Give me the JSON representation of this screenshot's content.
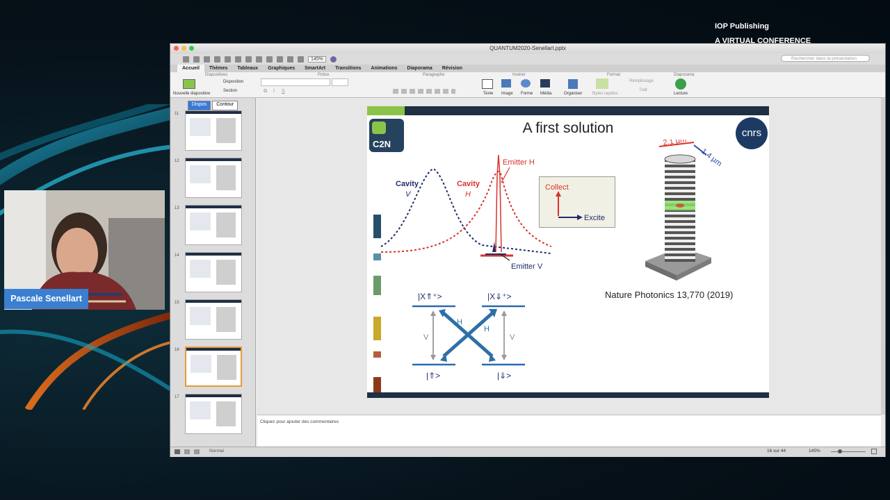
{
  "overlay": {
    "brand": "IOP Publishing",
    "subtitle": "A VIRTUAL CONFERENCE"
  },
  "speaker": {
    "name": "Pascale Senellart"
  },
  "window": {
    "title": "QUANTUM2020-Senellart.pptx",
    "zoom": "145%",
    "search_placeholder": "Rechercher dans la présentation"
  },
  "ribbon": {
    "tabs": [
      "Accueil",
      "Thèmes",
      "Tableaux",
      "Graphiques",
      "SmartArt",
      "Transitions",
      "Animations",
      "Diaporama",
      "Révision"
    ],
    "groups": {
      "diapositives": "Diapositives",
      "police": "Police",
      "paragraphe": "Paragraphe",
      "inserer": "Insérer",
      "format": "Format",
      "diaporama": "Diaporama"
    },
    "nouvelle_diapositive": "Nouvelle diapositive",
    "disposition": "Disposition",
    "section": "Section",
    "texte": "Texte",
    "image": "Image",
    "forme": "Forme",
    "media": "Média",
    "organiser": "Organiser",
    "styles_rapides": "Styles rapides",
    "remplissage": "Remplissage",
    "trait": "Trait",
    "lecture": "Lecture"
  },
  "panel": {
    "tab_slides": "Dispos",
    "tab_outline": "Contour",
    "slide_numbers": [
      "11",
      "12",
      "13",
      "14",
      "15",
      "16",
      "17"
    ],
    "selected": "16"
  },
  "slide": {
    "title": "A first solution",
    "logo_left": "C2N",
    "logo_right": "cnrs",
    "cavity_v": "Cavity",
    "cavity_v_sub": "V",
    "cavity_h": "Cavity",
    "cavity_h_sub": "H",
    "emitter_h": "Emitter H",
    "emitter_v": "Emitter V",
    "collect": "Collect",
    "excite": "Excite",
    "dim1": "2.1 µm",
    "dim2": "1.4 µm",
    "citation": "Nature Photonics  13,770 (2019)",
    "state_x_up": "|X⇑⁺>",
    "state_x_down": "|X⇓⁺>",
    "state_up": "|⇑>",
    "state_down": "|⇓>",
    "label_h": "H",
    "label_v": "V"
  },
  "notes": {
    "placeholder": "Cliquez pour ajouter des commentaires"
  },
  "status": {
    "view": "Normal",
    "slide_count": "16 sur 44",
    "zoom": "145%"
  },
  "colors": {
    "accent_green": "#8bc44a",
    "dark_navy": "#1f2f44",
    "name_tag_blue": "#3b7fd0",
    "cavity_v_color": "#1f2e6b",
    "cavity_h_color": "#d8322b"
  }
}
